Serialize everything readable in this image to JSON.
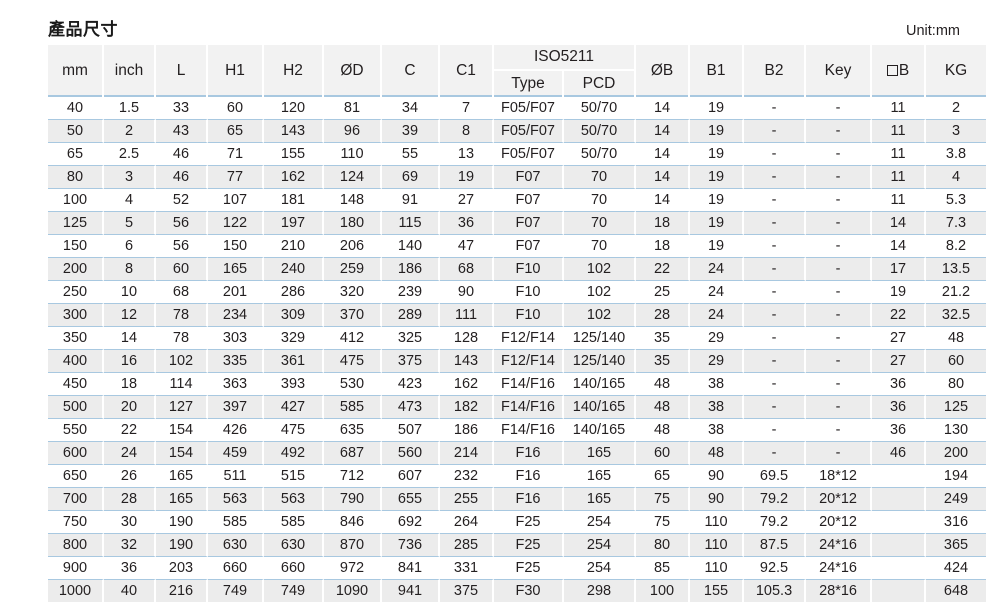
{
  "title": "產品尺寸",
  "unit_label": "Unit:mm",
  "table": {
    "group_header": {
      "iso_label": "ISO5211"
    },
    "columns": [
      {
        "key": "mm",
        "label": "mm"
      },
      {
        "key": "inch",
        "label": "inch"
      },
      {
        "key": "l",
        "label": "L"
      },
      {
        "key": "h1",
        "label": "H1"
      },
      {
        "key": "h2",
        "label": "H2"
      },
      {
        "key": "od",
        "label": "ØD"
      },
      {
        "key": "c",
        "label": "C"
      },
      {
        "key": "c1",
        "label": "C1"
      },
      {
        "key": "type",
        "label": "Type"
      },
      {
        "key": "pcd",
        "label": "PCD"
      },
      {
        "key": "ob",
        "label": "ØB"
      },
      {
        "key": "b1",
        "label": "B1"
      },
      {
        "key": "b2",
        "label": "B2"
      },
      {
        "key": "key",
        "label": "Key"
      },
      {
        "key": "sqb",
        "label": "B",
        "icon": "square-icon"
      },
      {
        "key": "kg",
        "label": "KG"
      }
    ],
    "rows": [
      [
        "40",
        "1.5",
        "33",
        "60",
        "120",
        "81",
        "34",
        "7",
        "F05/F07",
        "50/70",
        "14",
        "19",
        "-",
        "-",
        "11",
        "2"
      ],
      [
        "50",
        "2",
        "43",
        "65",
        "143",
        "96",
        "39",
        "8",
        "F05/F07",
        "50/70",
        "14",
        "19",
        "-",
        "-",
        "11",
        "3"
      ],
      [
        "65",
        "2.5",
        "46",
        "71",
        "155",
        "110",
        "55",
        "13",
        "F05/F07",
        "50/70",
        "14",
        "19",
        "-",
        "-",
        "11",
        "3.8"
      ],
      [
        "80",
        "3",
        "46",
        "77",
        "162",
        "124",
        "69",
        "19",
        "F07",
        "70",
        "14",
        "19",
        "-",
        "-",
        "11",
        "4"
      ],
      [
        "100",
        "4",
        "52",
        "107",
        "181",
        "148",
        "91",
        "27",
        "F07",
        "70",
        "14",
        "19",
        "-",
        "-",
        "11",
        "5.3"
      ],
      [
        "125",
        "5",
        "56",
        "122",
        "197",
        "180",
        "115",
        "36",
        "F07",
        "70",
        "18",
        "19",
        "-",
        "-",
        "14",
        "7.3"
      ],
      [
        "150",
        "6",
        "56",
        "150",
        "210",
        "206",
        "140",
        "47",
        "F07",
        "70",
        "18",
        "19",
        "-",
        "-",
        "14",
        "8.2"
      ],
      [
        "200",
        "8",
        "60",
        "165",
        "240",
        "259",
        "186",
        "68",
        "F10",
        "102",
        "22",
        "24",
        "-",
        "-",
        "17",
        "13.5"
      ],
      [
        "250",
        "10",
        "68",
        "201",
        "286",
        "320",
        "239",
        "90",
        "F10",
        "102",
        "25",
        "24",
        "-",
        "-",
        "19",
        "21.2"
      ],
      [
        "300",
        "12",
        "78",
        "234",
        "309",
        "370",
        "289",
        "111",
        "F10",
        "102",
        "28",
        "24",
        "-",
        "-",
        "22",
        "32.5"
      ],
      [
        "350",
        "14",
        "78",
        "303",
        "329",
        "412",
        "325",
        "128",
        "F12/F14",
        "125/140",
        "35",
        "29",
        "-",
        "-",
        "27",
        "48"
      ],
      [
        "400",
        "16",
        "102",
        "335",
        "361",
        "475",
        "375",
        "143",
        "F12/F14",
        "125/140",
        "35",
        "29",
        "-",
        "-",
        "27",
        "60"
      ],
      [
        "450",
        "18",
        "114",
        "363",
        "393",
        "530",
        "423",
        "162",
        "F14/F16",
        "140/165",
        "48",
        "38",
        "-",
        "-",
        "36",
        "80"
      ],
      [
        "500",
        "20",
        "127",
        "397",
        "427",
        "585",
        "473",
        "182",
        "F14/F16",
        "140/165",
        "48",
        "38",
        "-",
        "-",
        "36",
        "125"
      ],
      [
        "550",
        "22",
        "154",
        "426",
        "475",
        "635",
        "507",
        "186",
        "F14/F16",
        "140/165",
        "48",
        "38",
        "-",
        "-",
        "36",
        "130"
      ],
      [
        "600",
        "24",
        "154",
        "459",
        "492",
        "687",
        "560",
        "214",
        "F16",
        "165",
        "60",
        "48",
        "-",
        "-",
        "46",
        "200"
      ],
      [
        "650",
        "26",
        "165",
        "511",
        "515",
        "712",
        "607",
        "232",
        "F16",
        "165",
        "65",
        "90",
        "69.5",
        "18*12",
        "",
        "194"
      ],
      [
        "700",
        "28",
        "165",
        "563",
        "563",
        "790",
        "655",
        "255",
        "F16",
        "165",
        "75",
        "90",
        "79.2",
        "20*12",
        "",
        "249"
      ],
      [
        "750",
        "30",
        "190",
        "585",
        "585",
        "846",
        "692",
        "264",
        "F25",
        "254",
        "75",
        "110",
        "79.2",
        "20*12",
        "",
        "316"
      ],
      [
        "800",
        "32",
        "190",
        "630",
        "630",
        "870",
        "736",
        "285",
        "F25",
        "254",
        "80",
        "110",
        "87.5",
        "24*16",
        "",
        "365"
      ],
      [
        "900",
        "36",
        "203",
        "660",
        "660",
        "972",
        "841",
        "331",
        "F25",
        "254",
        "85",
        "110",
        "92.5",
        "24*16",
        "",
        "424"
      ],
      [
        "1000",
        "40",
        "216",
        "749",
        "749",
        "1090",
        "941",
        "375",
        "F30",
        "298",
        "100",
        "155",
        "105.3",
        "28*16",
        "",
        "648"
      ]
    ]
  },
  "colors": {
    "row_stripe": "#ececec",
    "header_bg": "#f2f2f2",
    "rule": "#a8c8e0",
    "text": "#231f20"
  }
}
